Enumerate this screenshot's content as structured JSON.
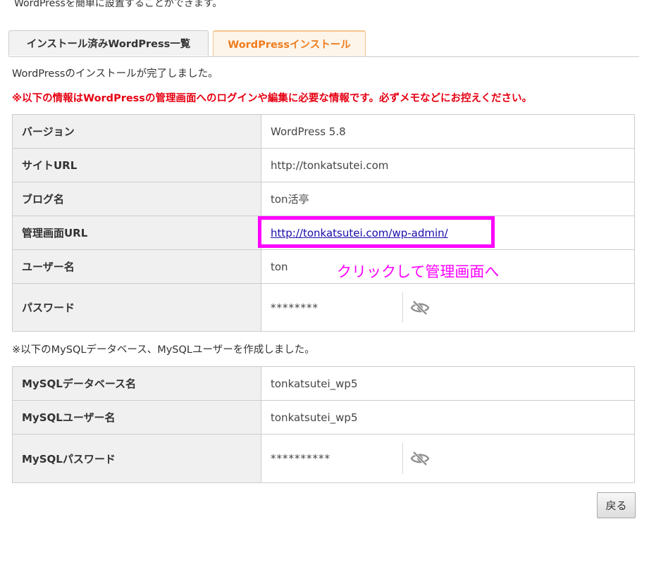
{
  "intro_text": "WordPressを簡単に設置することができます。",
  "tabs": [
    {
      "label": "インストール済みWordPress一覧",
      "active": false
    },
    {
      "label": "WordPressインストール",
      "active": true
    }
  ],
  "complete_message": "WordPressのインストールが完了しました。",
  "warning_message": "※以下の情報はWordPressの管理画面へのログインや編集に必要な情報です。必ずメモなどにお控えください。",
  "install_info": {
    "version": {
      "label": "バージョン",
      "value": "WordPress 5.8"
    },
    "site_url": {
      "label": "サイトURL",
      "value": "http://tonkatsutei.com"
    },
    "blog_name": {
      "label": "ブログ名",
      "value": "ton活亭"
    },
    "admin_url": {
      "label": "管理画面URL",
      "value": "http://tonkatsutei.com/wp-admin/"
    },
    "user_name": {
      "label": "ユーザー名",
      "value": "ton"
    },
    "password": {
      "label": "パスワード",
      "value": "********"
    }
  },
  "annotation": "クリックして管理画面へ",
  "mysql_note": "※以下のMySQLデータベース、MySQLユーザーを作成しました。",
  "mysql_info": {
    "db_name": {
      "label": "MySQLデータベース名",
      "value": "tonkatsutei_wp5"
    },
    "db_user": {
      "label": "MySQLユーザー名",
      "value": "tonkatsutei_wp5"
    },
    "db_password": {
      "label": "MySQLパスワード",
      "value": "**********"
    }
  },
  "back_button": "戻る",
  "colors": {
    "warning": "#e60012",
    "active_tab": "#ef7d1e",
    "highlight": "#ff00ff",
    "link": "#1a0dab"
  },
  "icons": {
    "password_toggle": "eye-slash-icon"
  }
}
